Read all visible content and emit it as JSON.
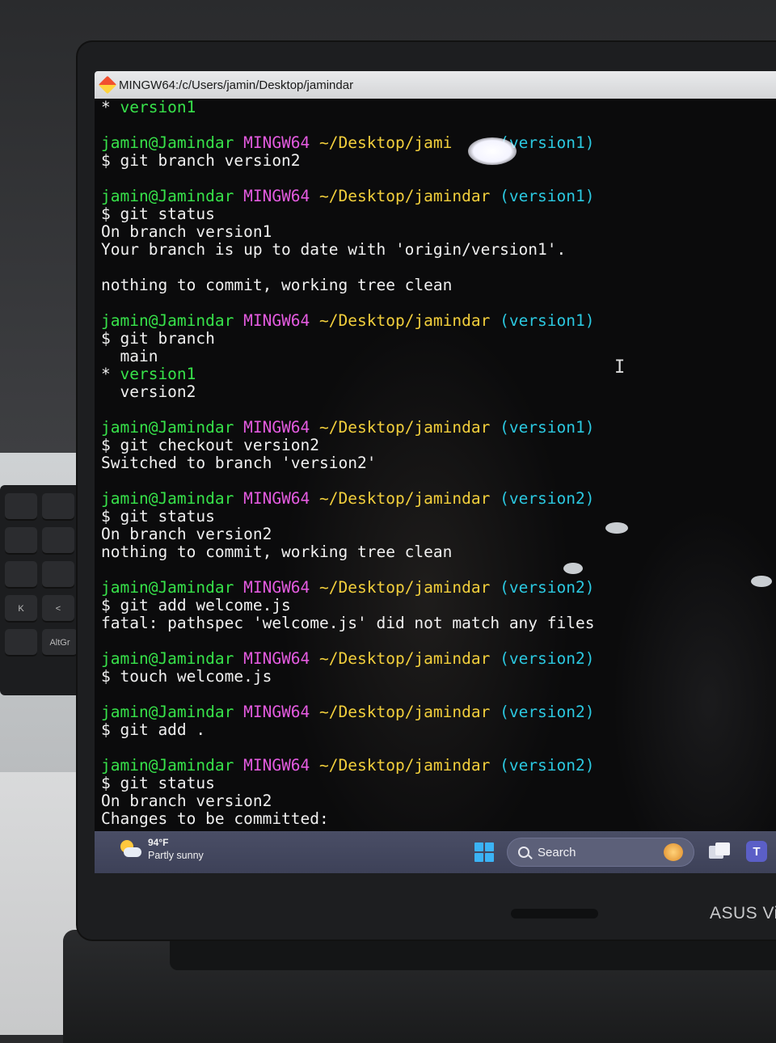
{
  "window": {
    "title": "MINGW64:/c/Users/jamin/Desktop/jamindar"
  },
  "terminal": {
    "lines": [
      [
        {
          "t": "* ",
          "c": "w"
        },
        {
          "t": "version1",
          "c": "g"
        }
      ],
      [],
      [
        {
          "t": "jamin@Jamindar ",
          "c": "g"
        },
        {
          "t": "MINGW64 ",
          "c": "m"
        },
        {
          "t": "~/Desktop/jami",
          "c": "y"
        },
        {
          "t": "     ",
          "c": "y"
        },
        {
          "t": "(version1)",
          "c": "c"
        }
      ],
      [
        {
          "t": "$ git branch version2",
          "c": "w"
        }
      ],
      [],
      [
        {
          "t": "jamin@Jamindar ",
          "c": "g"
        },
        {
          "t": "MINGW64 ",
          "c": "m"
        },
        {
          "t": "~/Desktop/jamindar ",
          "c": "y"
        },
        {
          "t": "(version1)",
          "c": "c"
        }
      ],
      [
        {
          "t": "$ git status",
          "c": "w"
        }
      ],
      [
        {
          "t": "On branch version1",
          "c": "w"
        }
      ],
      [
        {
          "t": "Your branch is up to date with 'origin/version1'.",
          "c": "w"
        }
      ],
      [],
      [
        {
          "t": "nothing to commit, working tree clean",
          "c": "w"
        }
      ],
      [],
      [
        {
          "t": "jamin@Jamindar ",
          "c": "g"
        },
        {
          "t": "MINGW64 ",
          "c": "m"
        },
        {
          "t": "~/Desktop/jamindar ",
          "c": "y"
        },
        {
          "t": "(version1)",
          "c": "c"
        }
      ],
      [
        {
          "t": "$ git branch",
          "c": "w"
        }
      ],
      [
        {
          "t": "  main",
          "c": "w"
        }
      ],
      [
        {
          "t": "* ",
          "c": "w"
        },
        {
          "t": "version1",
          "c": "g"
        }
      ],
      [
        {
          "t": "  version2",
          "c": "w"
        }
      ],
      [],
      [
        {
          "t": "jamin@Jamindar ",
          "c": "g"
        },
        {
          "t": "MINGW64 ",
          "c": "m"
        },
        {
          "t": "~/Desktop/jamindar ",
          "c": "y"
        },
        {
          "t": "(version1)",
          "c": "c"
        }
      ],
      [
        {
          "t": "$ git checkout version2",
          "c": "w"
        }
      ],
      [
        {
          "t": "Switched to branch 'version2'",
          "c": "w"
        }
      ],
      [],
      [
        {
          "t": "jamin@Jamindar ",
          "c": "g"
        },
        {
          "t": "MINGW64 ",
          "c": "m"
        },
        {
          "t": "~/Desktop/jamindar ",
          "c": "y"
        },
        {
          "t": "(version2)",
          "c": "c"
        }
      ],
      [
        {
          "t": "$ git status",
          "c": "w"
        }
      ],
      [
        {
          "t": "On branch version2",
          "c": "w"
        }
      ],
      [
        {
          "t": "nothing to commit, working tree clean",
          "c": "w"
        }
      ],
      [],
      [
        {
          "t": "jamin@Jamindar ",
          "c": "g"
        },
        {
          "t": "MINGW64 ",
          "c": "m"
        },
        {
          "t": "~/Desktop/jamindar ",
          "c": "y"
        },
        {
          "t": "(version2)",
          "c": "c"
        }
      ],
      [
        {
          "t": "$ git add welcome.js",
          "c": "w"
        }
      ],
      [
        {
          "t": "fatal: pathspec 'welcome.js' did not match any files",
          "c": "w"
        }
      ],
      [],
      [
        {
          "t": "jamin@Jamindar ",
          "c": "g"
        },
        {
          "t": "MINGW64 ",
          "c": "m"
        },
        {
          "t": "~/Desktop/jamindar ",
          "c": "y"
        },
        {
          "t": "(version2)",
          "c": "c"
        }
      ],
      [
        {
          "t": "$ touch welcome.js",
          "c": "w"
        }
      ],
      [],
      [
        {
          "t": "jamin@Jamindar ",
          "c": "g"
        },
        {
          "t": "MINGW64 ",
          "c": "m"
        },
        {
          "t": "~/Desktop/jamindar ",
          "c": "y"
        },
        {
          "t": "(version2)",
          "c": "c"
        }
      ],
      [
        {
          "t": "$ git add .",
          "c": "w"
        }
      ],
      [],
      [
        {
          "t": "jamin@Jamindar ",
          "c": "g"
        },
        {
          "t": "MINGW64 ",
          "c": "m"
        },
        {
          "t": "~/Desktop/jamindar ",
          "c": "y"
        },
        {
          "t": "(version2)",
          "c": "c"
        }
      ],
      [
        {
          "t": "$ git status",
          "c": "w"
        }
      ],
      [
        {
          "t": "On branch version2",
          "c": "w"
        }
      ],
      [
        {
          "t": "Changes to be committed:",
          "c": "w"
        }
      ]
    ]
  },
  "colors": {
    "user_host": "#37e24a",
    "mingw": "#e45be0",
    "path": "#f2cf3c",
    "branch": "#2bc8e0",
    "text": "#f0f0f0",
    "terminal_bg": "#0b0b0c",
    "taskbar_bg": "#4a4e66"
  },
  "taskbar": {
    "weather_temp": "94°F",
    "weather_desc": "Partly sunny",
    "weather_icon": "partly-sunny-icon",
    "start_icon": "windows-start-icon",
    "search_label": "Search",
    "search_icon": "search-icon",
    "taskview_icon": "task-view-icon",
    "teams_icon": "teams-icon",
    "teams_letter": "T"
  },
  "laptop": {
    "brand": "ASUS Vi"
  },
  "keyboard": {
    "keys": [
      "K",
      "<",
      "AltGr"
    ]
  }
}
